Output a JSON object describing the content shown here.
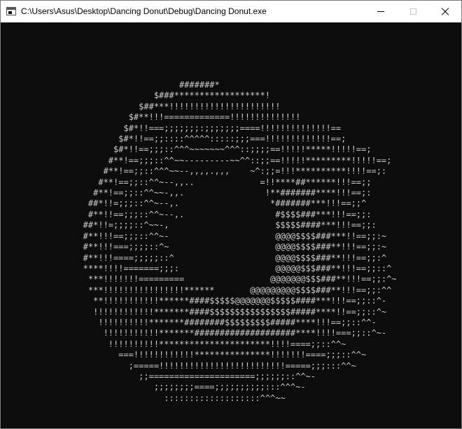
{
  "window": {
    "title": "C:\\Users\\Asus\\Desktop\\Dancing Donut\\Debug\\Dancing Donut.exe",
    "icon": "console-app-icon",
    "controls": {
      "minimize": "minimize-icon",
      "maximize": "maximize-icon",
      "close": "close-icon"
    }
  },
  "console": {
    "background": "#0c0c0c",
    "foreground": "#cccccc",
    "lines": [
      "                      #######*",
      "                 $###******************!",
      "              $##***!!!!!!!!!!!!!!!!!!!!!!",
      "            $#**!!!=============!!!!!!!!!!!!!!",
      "           $#*!!===;;;;;;;:;;;;;;;====!!!!!!!!!!!!!!==",
      "          $#*!!==;;::::^^^^^:::::;;;===!!!!!!!!!!!!!==;",
      "         $#*!!==;;;::^^^~~~~~~~^^^::;;;;==!!!!!*****!!!!!==;",
      "        #**!==;;;::^^~~---------~~^^::;;==!!!!!*********!!!!!==;",
      "       #**!==;;::^^^~~--,,,,.,,,    ~^:;;=!!!**********!!!!==;:",
      "      #**!==;;::^^~--,,..             =!!****##******!!!==;;",
      "     #**!==;;::^^~~-,,.                !**#######****!!!==;:",
      "    ##*!!=;;;::^^~--,.                  *#######***!!!==;;^",
      "    #**!!==;;;::^^~--,.                  #$$$$###***!!!==;;:",
      "   ##*!!=;;;;::^~~-,                     $$$$$####***!!!==;;:",
      "   #**!!!==;;;::^^~-                     @@@@$$$$###***!!==;;:~",
      "   #**!!!===;;;;::^~                     @@@@$$$$###**!!!==;;:~",
      "   #**!!!====;;;;;::^                    @@@@$$$$###**!!!==;;:^",
      "   ****!!!!=======;;;:                   @@@@@$$$###**!!!==;;::^",
      "    ***!!!!!!!=========                 @@@@@@@$$$###**!!!==;;:^~",
      "    ***!!!!!!!!!!!!!!!!******       @@@@@@@@@$$$$###**!!!==;;:^^",
      "     **!!!!!!!!!!!******####$$$$$@@@@@@@$$$$$####***!!!==;;::^-",
      "     !!!!!!!!!!!!*******####$$$$$$$$$$$$$$$$#####****!!==;;::^~",
      "      !!!!!!!!!!*******########$$$$$$$$$#####****!!!==;;::^^-",
      "       !!!!!!!!!!!*******####################****!!!!===;;::^~-",
      "        !!!!!!!!!!**********************!!!!====;;::^^~",
      "          ===!!!!!!!!!!!!***************!!!!!!!====;;;::^^~",
      "            ;=====!!!!!!!!!!!!!!!!!!!!!!!!!=====;;;:::^^~",
      "              ;;=====================;;;;;;::^^~-",
      "                 ;;;;;;;;====;;;;;;;;;;:::^^^~-",
      "                   :::::::::::::::::::^^^~~"
    ]
  }
}
